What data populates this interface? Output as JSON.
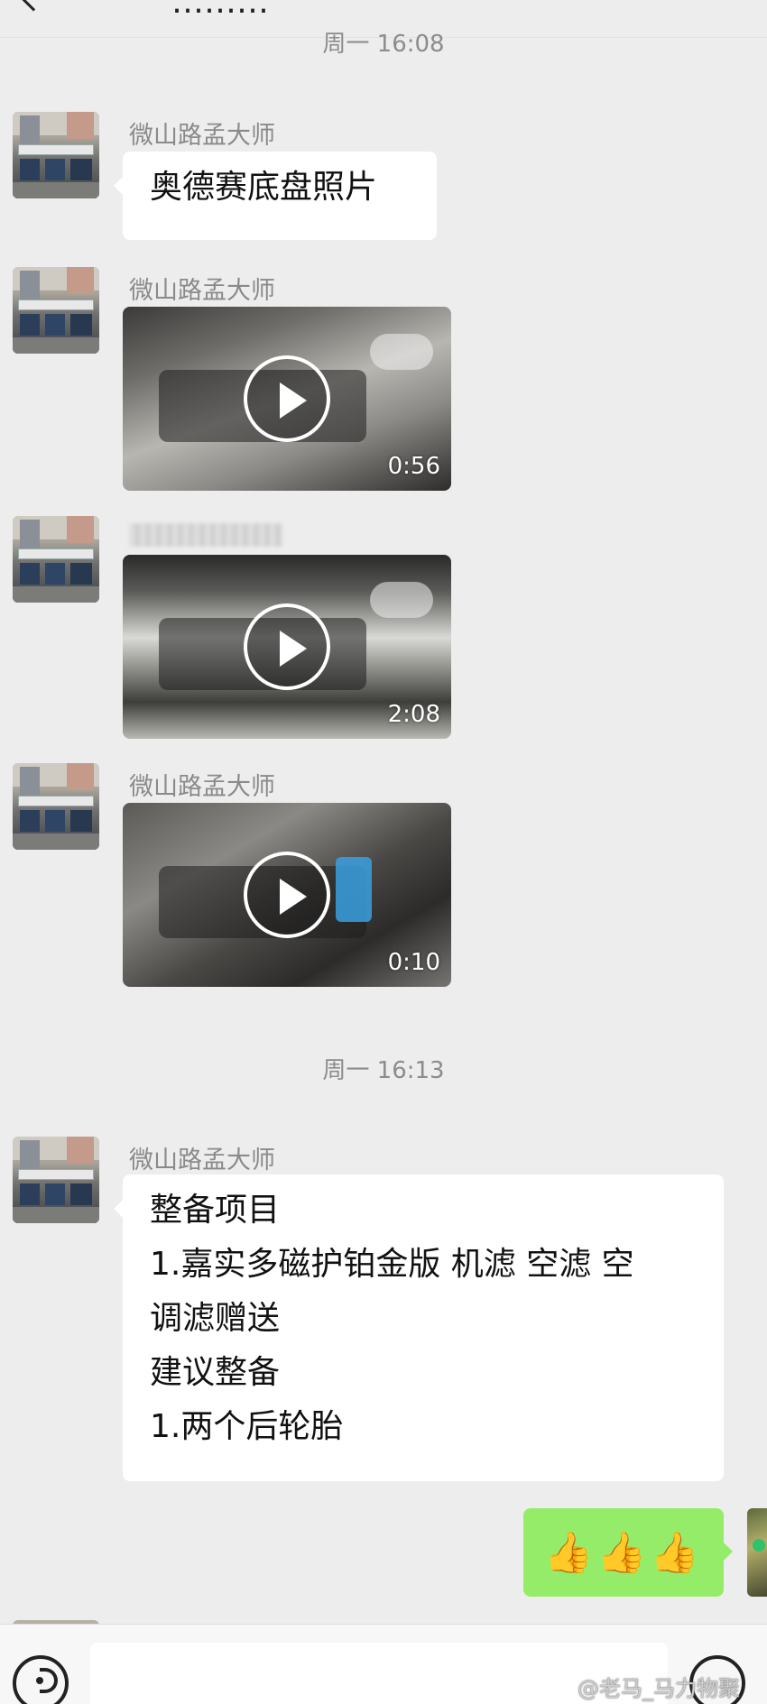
{
  "header": {
    "back_icon": "chevron-left-icon",
    "title": "………"
  },
  "messages": {
    "timestamp_1": "周一 16:08",
    "msg1": {
      "sender": "微山路孟大师",
      "text": "奥德赛底盘照片"
    },
    "msg2": {
      "sender": "微山路孟大师",
      "duration": "0:56"
    },
    "msg3": {
      "sender_blurred": true,
      "duration": "2:08"
    },
    "msg4": {
      "sender": "微山路孟大师",
      "duration": "0:10"
    },
    "timestamp_2": "周一 16:13",
    "msg5": {
      "sender": "微山路孟大师",
      "lines": [
        "整备项目",
        "1.嘉实多磁护铂金版 机滤 空滤 空",
        "调滤赠送",
        "建议整备",
        "1.两个后轮胎"
      ]
    },
    "reply": {
      "text": "👍👍👍"
    }
  },
  "input_bar": {
    "voice_icon": "voice-icon",
    "emoji_icon": "emoji-icon"
  },
  "watermark": "@老马_马力物聚"
}
